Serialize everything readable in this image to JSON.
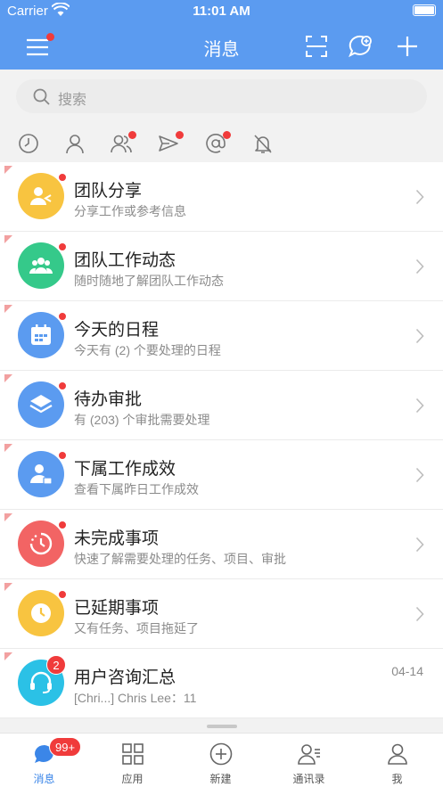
{
  "status_bar": {
    "carrier": "Carrier",
    "time": "11:01 AM"
  },
  "nav": {
    "title": "消息"
  },
  "search": {
    "placeholder": "搜索"
  },
  "filters": [
    "clock-icon",
    "person-icon",
    "group-icon",
    "send-icon",
    "at-icon",
    "bell-off-icon"
  ],
  "items": [
    {
      "title": "团队分享",
      "subtitle": "分享工作或参考信息",
      "color": "#f8c440",
      "icon": "share-person-icon"
    },
    {
      "title": "团队工作动态",
      "subtitle": "随时随地了解团队工作动态",
      "color": "#35c98a",
      "icon": "team-icon"
    },
    {
      "title": "今天的日程",
      "subtitle": "今天有 (2) 个要处理的日程",
      "color": "#5b9bf0",
      "icon": "calendar-icon"
    },
    {
      "title": "待办审批",
      "subtitle": "有 (203) 个审批需要处理",
      "color": "#5b9bf0",
      "icon": "layers-icon"
    },
    {
      "title": "下属工作成效",
      "subtitle": "查看下属昨日工作成效",
      "color": "#5b9bf0",
      "icon": "subordinate-icon"
    },
    {
      "title": "未完成事项",
      "subtitle": "快速了解需要处理的任务、项目、审批",
      "color": "#f26464",
      "icon": "clock-pending-icon"
    },
    {
      "title": "已延期事项",
      "subtitle": "又有任务、项目拖延了",
      "color": "#f8c440",
      "icon": "clock-icon"
    },
    {
      "title": "用户咨询汇总",
      "subtitle": "[Chri...] Chris Lee：11",
      "color": "#2bc1e6",
      "icon": "headset-icon",
      "date": "04-14",
      "badge": "2"
    }
  ],
  "tabs": [
    {
      "label": "消息",
      "icon": "chat-icon",
      "badge": "99+",
      "active": true
    },
    {
      "label": "应用",
      "icon": "grid-icon"
    },
    {
      "label": "新建",
      "icon": "plus-circle-icon"
    },
    {
      "label": "通讯录",
      "icon": "contacts-icon"
    },
    {
      "label": "我",
      "icon": "user-icon"
    }
  ],
  "colors": {
    "primary": "#5b9bf0",
    "badge": "#f03b3b",
    "active_tab": "#3b86e8"
  }
}
